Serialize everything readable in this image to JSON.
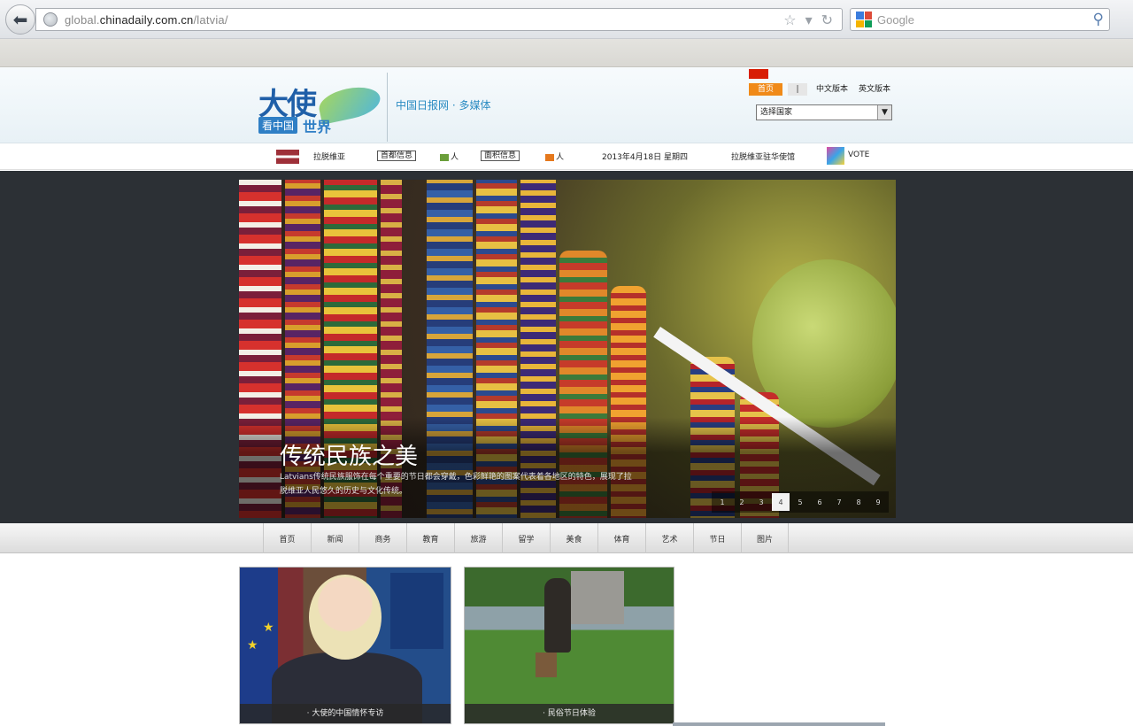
{
  "browser": {
    "url_prefix": "global.",
    "url_domain": "chinadaily.com.cn",
    "url_path": "/latvia/",
    "search_placeholder": "Google"
  },
  "header": {
    "logo_main": "大使",
    "logo_sub": "看中国",
    "logo_sub2": "世界",
    "tagline": "中国日报网 · 多媒体",
    "lang_home": "首页",
    "lang_sep": "|",
    "lang_link1": "中文版本",
    "lang_link2": "英文版本",
    "country_select_value": "选择国家"
  },
  "info_strip": {
    "country": "拉脱维亚",
    "box1": "首都信息",
    "pop_label": "人",
    "box2": "面积信息",
    "pop2_label": "人",
    "date": "2013年4月18日 星期四",
    "embassy": "拉脱维亚驻华使馆",
    "vote": "VOTE"
  },
  "hero": {
    "title": "传统民族之美",
    "text": "Latvians传统民族服饰在每个重要的节日都会穿戴，色彩鲜艳的图案代表着各地区的特色，展现了拉脱维亚人民悠久的历史与文化传统。",
    "pages": [
      "1",
      "2",
      "3",
      "4",
      "5",
      "6",
      "7",
      "8",
      "9"
    ],
    "active_page": "4"
  },
  "categories": [
    "首页",
    "新闻",
    "商务",
    "教育",
    "旅游",
    "留学",
    "美食",
    "体育",
    "艺术",
    "节日",
    "图片"
  ],
  "cards": [
    {
      "caption": "· 大使的中国情怀专访"
    },
    {
      "caption": "· 民俗节日体验"
    }
  ]
}
